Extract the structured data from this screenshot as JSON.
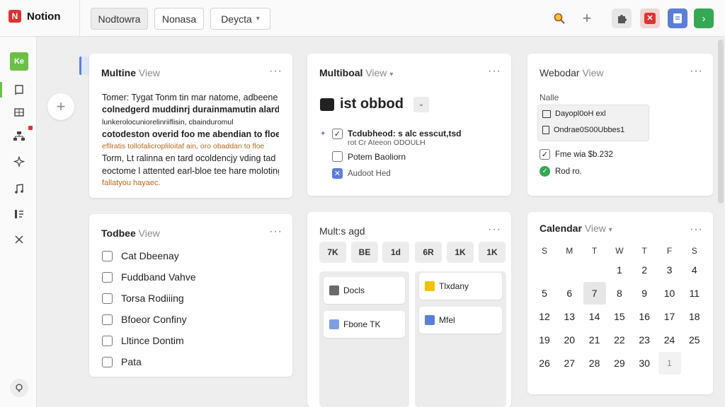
{
  "app": {
    "name": "Notion",
    "logo_letter": "N"
  },
  "toolbar": {
    "buttons": [
      "Nodtowra",
      "Nonasa"
    ],
    "dropdown": "Deycta",
    "icons": [
      "search-icon",
      "plus-icon",
      "puzzle-icon",
      "close-icon",
      "document-icon",
      "arrow-right-icon"
    ]
  },
  "sidebar": {
    "top_badge": "Ke",
    "icons": [
      "book-icon",
      "table-icon",
      "org-chart-icon",
      "sparkle-icon",
      "music-icon",
      "list-icon",
      "close-icon"
    ],
    "help_icon": "help-icon"
  },
  "cards": {
    "multline": {
      "title": "Multine",
      "view": "View",
      "lines": [
        "Tomer: Tygat Tonm tin mar natome, adbeene",
        "colnedgerd muddinrj durainmamutin alardand",
        "lunkerolocuniorelinriiflisin, cbainduromul",
        "cotodeston overid foo me abendian to floe",
        "efllratis tollofalicropliloitaf ain, oro obaddan to floe",
        "Torm, Lt ralinna en tard ocoldencjy vding tad",
        "eoctome l attented earl-bloe tee hare moloting",
        "fallatyou hayaec."
      ]
    },
    "multiboard": {
      "title": "Multiboal",
      "view": "View",
      "heading": "ist obbod",
      "items": [
        {
          "text": "Tcdubheod: s alc esscut,tsd",
          "sub": "rot Cr Ateeon ODOULH",
          "checked": true
        },
        {
          "text": "Potem Baoliorn",
          "checked": false
        },
        {
          "text": "Audoot Hed",
          "checked": false,
          "blue": true
        }
      ]
    },
    "webodar": {
      "title": "Webodar",
      "view": "View",
      "label": "Nalle",
      "files": [
        "Dayopl0oH exl",
        "Ondrae0S00Ubbes1"
      ],
      "checks": [
        {
          "text": "Fme wia $b.232",
          "type": "box"
        },
        {
          "text": "Rod ro.",
          "type": "circle"
        }
      ]
    },
    "todbee": {
      "title": "Todbee",
      "view": "View",
      "items": [
        "Cat Dbeenay",
        "Fuddband Vahve",
        "Torsa Rodiiing",
        "Bfoeor Confiny",
        "Lltince Dontim",
        "Pata"
      ]
    },
    "multsagd": {
      "title": "Mult:s agd",
      "tags": [
        "7K",
        "BE",
        "1d",
        "6R",
        "1K",
        "1K"
      ],
      "col1": [
        "Docls",
        "Fbone TK"
      ],
      "col2": [
        "Tlxdany",
        "Mfel"
      ]
    },
    "calendar": {
      "title": "Calendar",
      "view": "View",
      "dows": [
        "S",
        "M",
        "T",
        "W",
        "T",
        "F",
        "S"
      ],
      "weeks": [
        [
          "",
          "",
          "",
          "1",
          "2",
          "3",
          "4"
        ],
        [
          "5",
          "6",
          "7",
          "8",
          "9",
          "10",
          "11"
        ],
        [
          "12",
          "13",
          "14",
          "15",
          "16",
          "17",
          "18"
        ],
        [
          "19",
          "20",
          "21",
          "22",
          "23",
          "24",
          "25"
        ],
        [
          "26",
          "27",
          "28",
          "29",
          "30",
          "1",
          ""
        ]
      ],
      "selected": "7",
      "accent": "#5b7fd6"
    }
  },
  "colors": {
    "brand_red": "#e03131",
    "accent_blue": "#5b7fd6",
    "accent_green": "#34a853",
    "sidebar_green": "#6cc04a"
  }
}
